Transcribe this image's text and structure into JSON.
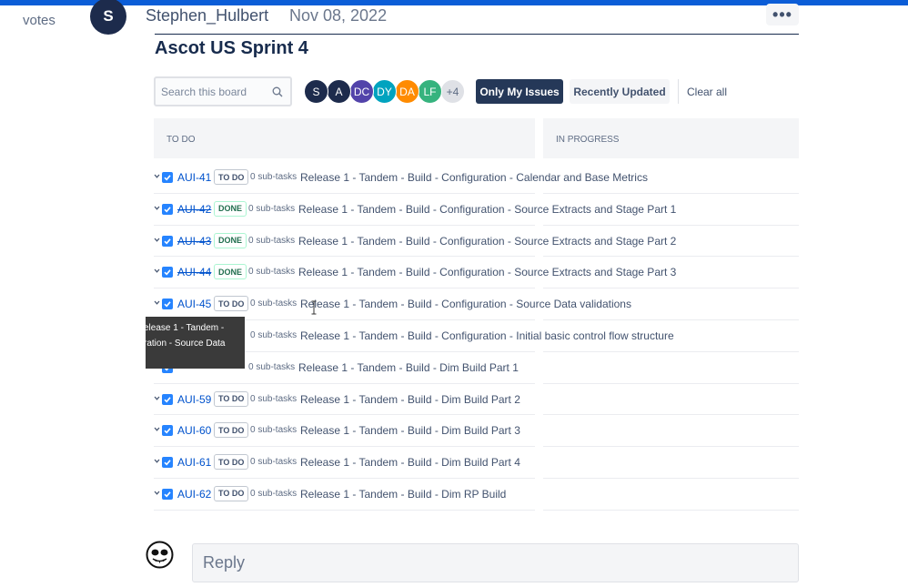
{
  "post": {
    "votes_label": "votes",
    "author_initial": "S",
    "author_name": "Stephen_Hulbert",
    "date": "Nov 08, 2022",
    "more_label": "•••"
  },
  "board": {
    "title": "Ascot US Sprint 4",
    "search_placeholder": "Search this board",
    "avatars": [
      {
        "label": "S",
        "color": "#1d2b4c"
      },
      {
        "label": "A",
        "color": "#1d2b4c"
      },
      {
        "label": "DC",
        "color": "#5243aa"
      },
      {
        "label": "DY",
        "color": "#00a3bf"
      },
      {
        "label": "DA",
        "color": "#ff8b00"
      },
      {
        "label": "LF",
        "color": "#36b37e"
      },
      {
        "label": "+4",
        "color": "#dfe1e6"
      }
    ],
    "only_my_issues": "Only My Issues",
    "recently_updated": "Recently Updated",
    "clear_all": "Clear all",
    "columns": [
      "TO DO",
      "IN PROGRESS"
    ]
  },
  "issues": [
    {
      "key": "AUI-41",
      "status": "TO DO",
      "done": false,
      "subtasks": "0 sub-tasks",
      "summary": "Release 1 - Tandem - Build - Configuration - Calendar and Base Metrics"
    },
    {
      "key": "AUI-42",
      "status": "DONE",
      "done": true,
      "subtasks": "0 sub-tasks",
      "summary": "Release 1 - Tandem - Build - Configuration - Source Extracts and Stage Part 1"
    },
    {
      "key": "AUI-43",
      "status": "DONE",
      "done": true,
      "subtasks": "0 sub-tasks",
      "summary": "Release 1 - Tandem - Build - Configuration - Source Extracts and Stage Part 2"
    },
    {
      "key": "AUI-44",
      "status": "DONE",
      "done": true,
      "subtasks": "0 sub-tasks",
      "summary": "Release 1 - Tandem - Build - Configuration - Source Extracts and Stage Part 3"
    },
    {
      "key": "AUI-45",
      "status": "TO DO",
      "done": false,
      "subtasks": "0 sub-tasks",
      "summary": "Release 1 - Tandem - Build - Configuration - Source Data validations"
    },
    {
      "key": "",
      "status": "",
      "done": false,
      "subtasks": "0 sub-tasks",
      "summary": "Release 1 - Tandem - Build - Configuration - Initial basic control flow structure"
    },
    {
      "key": "",
      "status": "",
      "done": true,
      "subtasks": "0 sub-tasks",
      "summary": "Release 1 - Tandem - Build - Dim Build Part 1"
    },
    {
      "key": "AUI-59",
      "status": "TO DO",
      "done": false,
      "subtasks": "0 sub-tasks",
      "summary": "Release 1 - Tandem - Build - Dim Build Part 2"
    },
    {
      "key": "AUI-60",
      "status": "TO DO",
      "done": false,
      "subtasks": "0 sub-tasks",
      "summary": "Release 1 - Tandem - Build - Dim Build Part 3"
    },
    {
      "key": "AUI-61",
      "status": "TO DO",
      "done": false,
      "subtasks": "0 sub-tasks",
      "summary": "Release 1 - Tandem - Build - Dim Build Part 4"
    },
    {
      "key": "AUI-62",
      "status": "TO DO",
      "done": false,
      "subtasks": "0 sub-tasks",
      "summary": "Release 1 - Tandem - Build - Dim RP Build"
    }
  ],
  "tooltip": {
    "line1": "elease 1 - Tandem -",
    "line2": "ration - Source Data"
  },
  "reply": {
    "placeholder": "Reply"
  },
  "colors": {
    "accent": "#0b5dd7",
    "link": "#0052cc",
    "checkbox": "#2684ff"
  }
}
